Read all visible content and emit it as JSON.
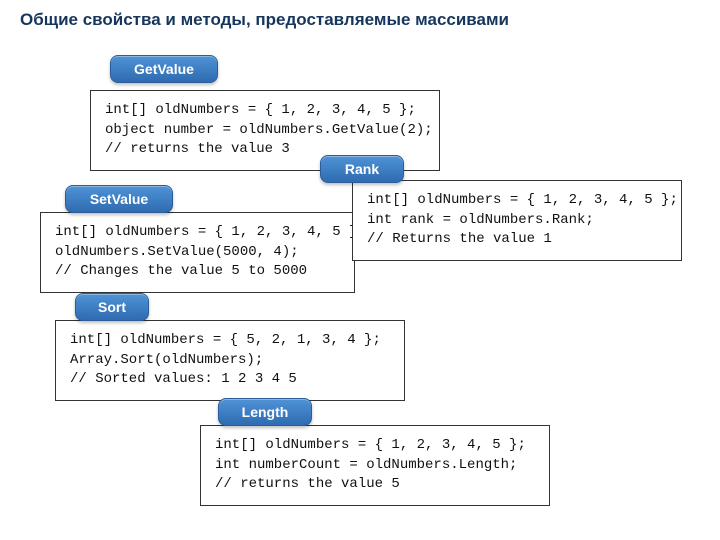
{
  "title": "Общие свойства и методы, предоставляемые массивами",
  "blocks": {
    "getvalue": {
      "label": "GetValue",
      "code": "int[] oldNumbers = { 1, 2, 3, 4, 5 };\nobject number = oldNumbers.GetValue(2);\n// returns the value 3"
    },
    "rank": {
      "label": "Rank",
      "code": "int[] oldNumbers = { 1, 2, 3, 4, 5 };\nint rank = oldNumbers.Rank;\n// Returns the value 1"
    },
    "setvalue": {
      "label": "SetValue",
      "code": "int[] oldNumbers = { 1, 2, 3, 4, 5 };\noldNumbers.SetValue(5000, 4);\n// Changes the value 5 to 5000"
    },
    "sort": {
      "label": "Sort",
      "code": "int[] oldNumbers = { 5, 2, 1, 3, 4 };\nArray.Sort(oldNumbers);\n// Sorted values: 1 2 3 4 5"
    },
    "length": {
      "label": "Length",
      "code": "int[] oldNumbers = { 1, 2, 3, 4, 5 };\nint numberCount = oldNumbers.Length;\n// returns the value 5"
    }
  }
}
